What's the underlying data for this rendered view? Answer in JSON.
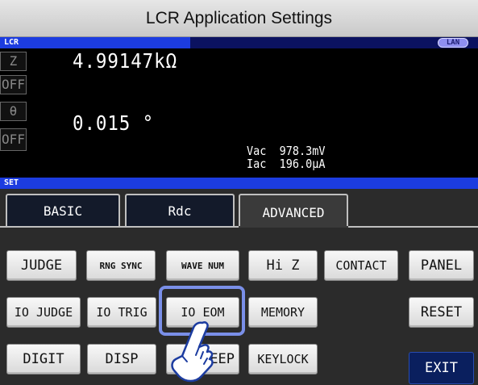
{
  "window": {
    "title": "LCR Application Settings"
  },
  "status_bar": {
    "mode": "LCR",
    "interface": "LAN"
  },
  "measurements": {
    "row1": {
      "param": "Z",
      "value": "4.99147kΩ"
    },
    "row2": {
      "param": "OFF"
    },
    "row3": {
      "param": "θ",
      "value": "0.015 °"
    },
    "row4": {
      "param": "OFF"
    },
    "monitor": {
      "vac_label": "Vac",
      "vac_value": "978.3mV",
      "iac_label": "Iac",
      "iac_value": "196.0μA"
    }
  },
  "set_bar": {
    "label": "SET"
  },
  "tabs": [
    {
      "label": "BASIC",
      "active": false
    },
    {
      "label": "Rdc",
      "active": false
    },
    {
      "label": "ADVANCED",
      "active": true
    }
  ],
  "buttons": {
    "judge": "JUDGE",
    "rng_sync": "RNG SYNC",
    "wave_num": "WAVE NUM",
    "hi_z": "Hi Z",
    "contact": "CONTACT",
    "panel": "PANEL",
    "io_judge": "IO JUDGE",
    "io_trig": "IO TRIG",
    "io_eom": "IO EOM",
    "memory": "MEMORY",
    "reset": "RESET",
    "digit": "DIGIT",
    "disp": "DISP",
    "beep": "BEEP",
    "keylock": "KEYLOCK",
    "exit": "EXIT"
  },
  "colors": {
    "status_stripe": "#1c3ce0",
    "highlight": "#7a8fe8",
    "exit_button": "#0a1f5e"
  },
  "icons": {
    "pointer": "hand-pointer-icon"
  }
}
